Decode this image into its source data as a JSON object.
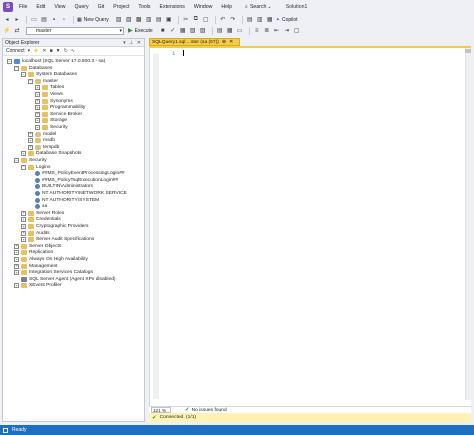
{
  "menubar": {
    "items": [
      "File",
      "Edit",
      "View",
      "Query",
      "Git",
      "Project",
      "Tools",
      "Extensions",
      "Window",
      "Help"
    ],
    "search_label": "Search",
    "solution_label": "Solution1"
  },
  "toolbar": {
    "new_query_label": "New Query",
    "copilot_label": "Copilot",
    "database_value": "master",
    "execute_label": "Execute"
  },
  "object_explorer": {
    "title": "Object Explorer",
    "connect_label": "Connect",
    "tree": [
      {
        "label": "localhost (SQL Server 17.0.800.3 - sa)",
        "toggle": "−",
        "icon": "server-icon"
      },
      {
        "label": "Databases",
        "toggle": "−",
        "icon": "folder-icon"
      },
      {
        "label": "System Databases",
        "toggle": "−",
        "icon": "folder-icon"
      },
      {
        "label": "master",
        "toggle": "−",
        "icon": "database-icon"
      },
      {
        "label": "Tables",
        "toggle": "+",
        "icon": "folder-icon"
      },
      {
        "label": "Views",
        "toggle": "+",
        "icon": "folder-icon"
      },
      {
        "label": "Synonyms",
        "toggle": "+",
        "icon": "folder-icon"
      },
      {
        "label": "Programmability",
        "toggle": "+",
        "icon": "folder-icon"
      },
      {
        "label": "Service Broker",
        "toggle": "+",
        "icon": "folder-icon"
      },
      {
        "label": "Storage",
        "toggle": "+",
        "icon": "folder-icon"
      },
      {
        "label": "Security",
        "toggle": "+",
        "icon": "folder-icon"
      },
      {
        "label": "model",
        "toggle": "+",
        "icon": "database-icon"
      },
      {
        "label": "msdb",
        "toggle": "+",
        "icon": "database-icon"
      },
      {
        "label": "tempdb",
        "toggle": "+",
        "icon": "database-icon"
      },
      {
        "label": "Database Snapshots",
        "toggle": "+",
        "icon": "folder-icon"
      },
      {
        "label": "Security",
        "toggle": "−",
        "icon": "folder-icon"
      },
      {
        "label": "Logins",
        "toggle": "−",
        "icon": "folder-icon"
      },
      {
        "label": "##MS_PolicyEventProcessingLogin##",
        "toggle": "",
        "icon": "login-icon"
      },
      {
        "label": "##MS_PolicyTsqlExecutionLogin##",
        "toggle": "",
        "icon": "login-icon"
      },
      {
        "label": "BUILTIN\\Administrators",
        "toggle": "",
        "icon": "login-icon"
      },
      {
        "label": "NT AUTHORITY\\NETWORK SERVICE",
        "toggle": "",
        "icon": "login-icon"
      },
      {
        "label": "NT AUTHORITY\\SYSTEM",
        "toggle": "",
        "icon": "login-icon"
      },
      {
        "label": "sa",
        "toggle": "",
        "icon": "login-icon"
      },
      {
        "label": "Server Roles",
        "toggle": "+",
        "icon": "folder-icon"
      },
      {
        "label": "Credentials",
        "toggle": "+",
        "icon": "folder-icon"
      },
      {
        "label": "Cryptographic Providers",
        "toggle": "+",
        "icon": "folder-icon"
      },
      {
        "label": "Audits",
        "toggle": "+",
        "icon": "folder-icon"
      },
      {
        "label": "Server Audit Specifications",
        "toggle": "+",
        "icon": "folder-icon"
      },
      {
        "label": "Server Objects",
        "toggle": "+",
        "icon": "folder-icon"
      },
      {
        "label": "Replication",
        "toggle": "+",
        "icon": "folder-icon"
      },
      {
        "label": "Always On High Availability",
        "toggle": "+",
        "icon": "folder-icon"
      },
      {
        "label": "Management",
        "toggle": "+",
        "icon": "folder-icon"
      },
      {
        "label": "Integration Services Catalogs",
        "toggle": "+",
        "icon": "folder-icon"
      },
      {
        "label": "SQL Server Agent (Agent XPs disabled)",
        "toggle": "",
        "icon": "agent-icon"
      },
      {
        "label": "XEvent Profiler",
        "toggle": "+",
        "icon": "folder-icon"
      }
    ]
  },
  "editor": {
    "tab_label": "SQLQuery1.sql ...ster (sa (57))",
    "line_number": "1",
    "zoom": "121 %",
    "issues_text": "No issues found",
    "connection_text": "Connected. (1/1)"
  },
  "statusbar": {
    "text": "Ready"
  }
}
